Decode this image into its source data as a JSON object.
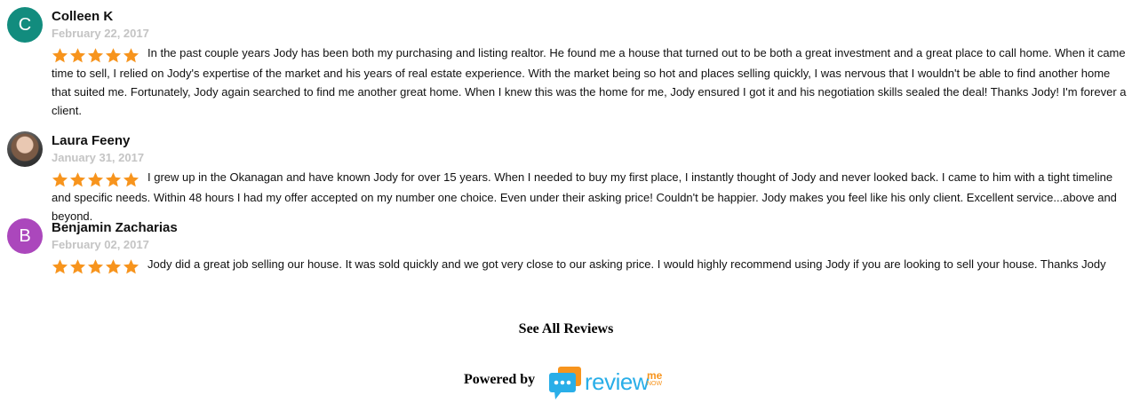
{
  "reviews": [
    {
      "avatar_initial": "C",
      "avatar_color": "#128c7e",
      "name": "Colleen K",
      "date": "February 22, 2017",
      "rating": 5,
      "text": "In the past couple years Jody has been both my purchasing and listing realtor. He found me a house that turned out to be both a great investment and a great place to call home. When it came time to sell, I relied on Jody's expertise of the market and his years of real estate experience. With the market being so hot and places selling quickly, I was nervous that I wouldn't be able to find another home that suited me. Fortunately, Jody again searched to find me another great home. When I knew this was the home for me, Jody ensured I got it and his negotiation skills sealed the deal! Thanks Jody! I'm forever a client."
    },
    {
      "avatar_initial": "",
      "avatar_color": "#555555",
      "name": "Laura Feeny",
      "date": "January 31, 2017",
      "rating": 5,
      "text": "I grew up in the Okanagan and have known Jody for over 15 years. When I needed to buy my first place, I instantly thought of Jody and never looked back. I came to him with a tight timeline and specific needs. Within 48 hours I had my offer accepted on my number one choice. Even under their asking price! Couldn't be happier. Jody makes you feel like his only client. Excellent service...above and beyond."
    },
    {
      "avatar_initial": "B",
      "avatar_color": "#ab47bc",
      "name": "Benjamin Zacharias",
      "date": "February 02, 2017",
      "rating": 5,
      "text": "Jody did a great job selling our house. It was sold quickly and we got very close to our asking price. I would highly recommend using Jody if you are looking to sell your house. Thanks Jody"
    }
  ],
  "see_all_label": "See All Reviews",
  "powered_by_label": "Powered by",
  "logo": {
    "word": "review",
    "me": "me",
    "now": "NOW",
    "primary_color": "#29aee8",
    "accent_color": "#f7941d"
  },
  "star_color": "#f7941d"
}
